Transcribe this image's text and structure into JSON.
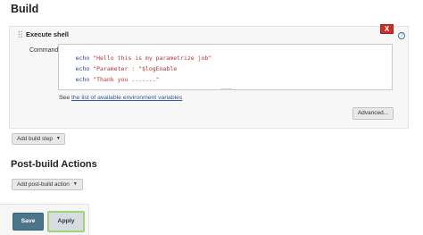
{
  "build": {
    "heading": "Build",
    "step": {
      "title": "Execute shell",
      "close_label": "X",
      "help_label": "?",
      "command_label": "Command",
      "code_lines": [
        {
          "keyword": "echo",
          "text": "\"Hello this is my parametrize job\""
        },
        {
          "keyword": "echo",
          "text": "\"Parameter : \"$logEnable"
        },
        {
          "keyword": "echo",
          "text": "\"Thank you .......\""
        }
      ],
      "see_prefix": "See ",
      "env_link_label": "the list of available environment variables",
      "advanced_label": "Advanced..."
    },
    "add_step_label": "Add build step"
  },
  "post_build": {
    "heading": "Post-build Actions",
    "add_action_label": "Add post-build action"
  },
  "footer": {
    "save_label": "Save",
    "apply_label": "Apply"
  },
  "colors": {
    "close": "#c9302c",
    "save": "#4b758b",
    "apply_focus": "#9fd37b",
    "link": "#2d5aa0"
  }
}
